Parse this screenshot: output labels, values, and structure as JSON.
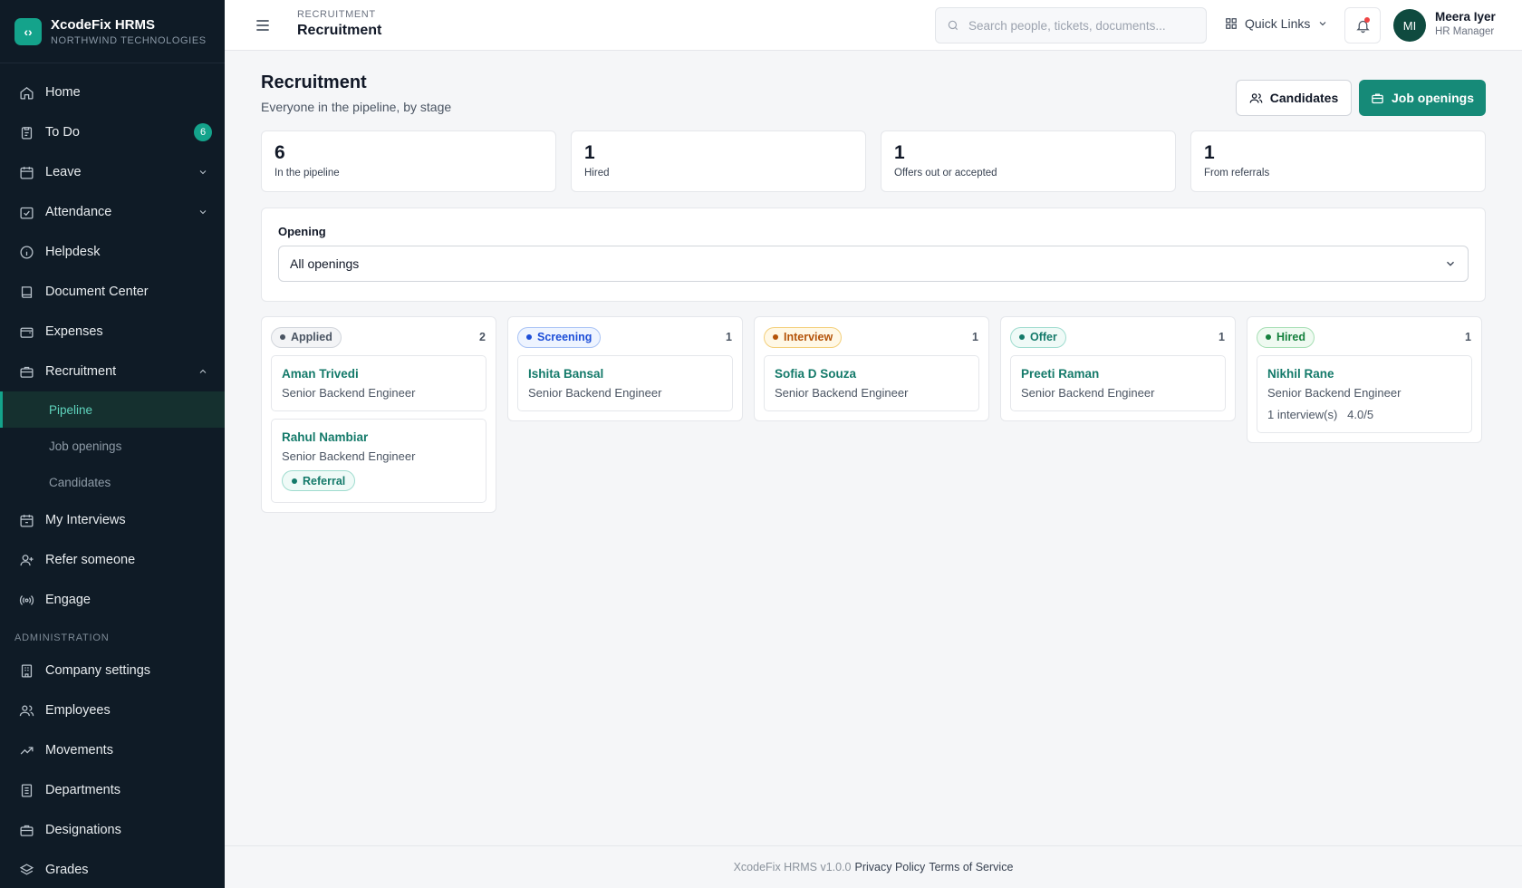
{
  "brand": {
    "name": "XcodeFix HRMS",
    "company": "NORTHWIND TECHNOLOGIES",
    "accent": "#14a38b"
  },
  "nav": {
    "home": "Home",
    "todo": "To Do",
    "todo_badge": "6",
    "leave": "Leave",
    "attendance": "Attendance",
    "helpdesk": "Helpdesk",
    "documents": "Document Center",
    "expenses": "Expenses",
    "recruitment": "Recruitment",
    "recruitment_sub": {
      "pipeline": "Pipeline",
      "job_openings": "Job openings",
      "candidates": "Candidates"
    },
    "my_interviews": "My Interviews",
    "refer": "Refer someone",
    "engage": "Engage",
    "admin_label": "ADMINISTRATION",
    "company_settings": "Company settings",
    "employees": "Employees",
    "movements": "Movements",
    "departments": "Departments",
    "designations": "Designations",
    "grades": "Grades"
  },
  "topbar": {
    "crumb_parent": "RECRUITMENT",
    "crumb_title": "Recruitment",
    "search_placeholder": "Search people, tickets, documents...",
    "quick_links": "Quick Links",
    "avatar_initials": "MI",
    "user_name": "Meera Iyer",
    "user_role": "HR Manager"
  },
  "page": {
    "title": "Recruitment",
    "subtitle": "Everyone in the pipeline, by stage",
    "btn_candidates": "Candidates",
    "btn_job_openings": "Job openings"
  },
  "stats": [
    {
      "value": "6",
      "label": "In the pipeline"
    },
    {
      "value": "1",
      "label": "Hired"
    },
    {
      "value": "1",
      "label": "Offers out or accepted"
    },
    {
      "value": "1",
      "label": "From referrals"
    }
  ],
  "filter": {
    "label": "Opening",
    "selected": "All openings"
  },
  "board": [
    {
      "stage": "Applied",
      "count": "2",
      "color": "#4b5563",
      "bg": "#f3f4f6",
      "border": "#d1d5db",
      "cards": [
        {
          "name": "Aman Trivedi",
          "role": "Senior Backend Engineer"
        },
        {
          "name": "Rahul Nambiar",
          "role": "Senior Backend Engineer",
          "tag": "Referral"
        }
      ]
    },
    {
      "stage": "Screening",
      "count": "1",
      "color": "#1d4ed8",
      "bg": "#eef4ff",
      "border": "#a9c3f5",
      "cards": [
        {
          "name": "Ishita Bansal",
          "role": "Senior Backend Engineer"
        }
      ]
    },
    {
      "stage": "Interview",
      "count": "1",
      "color": "#b45309",
      "bg": "#fff8e6",
      "border": "#f3cf7a",
      "cards": [
        {
          "name": "Sofia D Souza",
          "role": "Senior Backend Engineer"
        }
      ]
    },
    {
      "stage": "Offer",
      "count": "1",
      "color": "#147a6a",
      "bg": "#effaf7",
      "border": "#9fdccf",
      "cards": [
        {
          "name": "Preeti Raman",
          "role": "Senior Backend Engineer"
        }
      ]
    },
    {
      "stage": "Hired",
      "count": "1",
      "color": "#15803d",
      "bg": "#effaf1",
      "border": "#a7dfb5",
      "cards": [
        {
          "name": "Nikhil Rane",
          "role": "Senior Backend Engineer",
          "meta": "1 interview(s)   4.0/5"
        }
      ]
    }
  ],
  "footer": {
    "version": "XcodeFix HRMS v1.0.0",
    "privacy": "Privacy Policy",
    "terms": "Terms of Service"
  }
}
